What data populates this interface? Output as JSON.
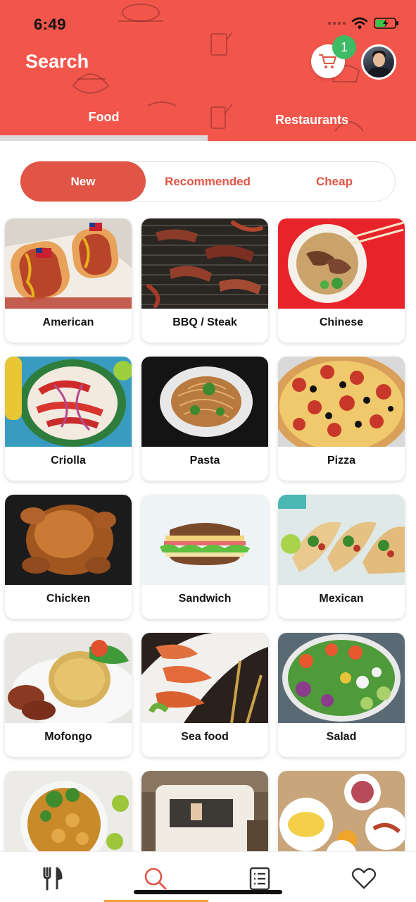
{
  "status_bar": {
    "time": "6:49"
  },
  "header": {
    "title": "Search",
    "cart_badge": "1",
    "tabs": [
      {
        "label": "Food",
        "active": true
      },
      {
        "label": "Restaurants",
        "active": false
      }
    ]
  },
  "filters": [
    {
      "label": "New",
      "active": true
    },
    {
      "label": "Recommended",
      "active": false
    },
    {
      "label": "Cheap",
      "active": false
    }
  ],
  "categories": [
    {
      "label": "American"
    },
    {
      "label": "BBQ / Steak"
    },
    {
      "label": "Chinese"
    },
    {
      "label": "Criolla"
    },
    {
      "label": "Pasta"
    },
    {
      "label": "Pizza"
    },
    {
      "label": "Chicken"
    },
    {
      "label": "Sandwich"
    },
    {
      "label": "Mexican"
    },
    {
      "label": "Mofongo"
    },
    {
      "label": "Sea food"
    },
    {
      "label": "Salad"
    },
    {
      "label": ""
    },
    {
      "label": ""
    },
    {
      "label": ""
    }
  ],
  "bottom_nav": [
    {
      "icon": "fork-knife-icon",
      "active": false
    },
    {
      "icon": "search-icon",
      "active": true
    },
    {
      "icon": "list-icon",
      "active": false
    },
    {
      "icon": "heart-icon",
      "active": false
    }
  ],
  "colors": {
    "brand": "#f2564b",
    "accent": "#e05545",
    "badge": "#3dbb65",
    "active_nav": "#f2a23a"
  }
}
